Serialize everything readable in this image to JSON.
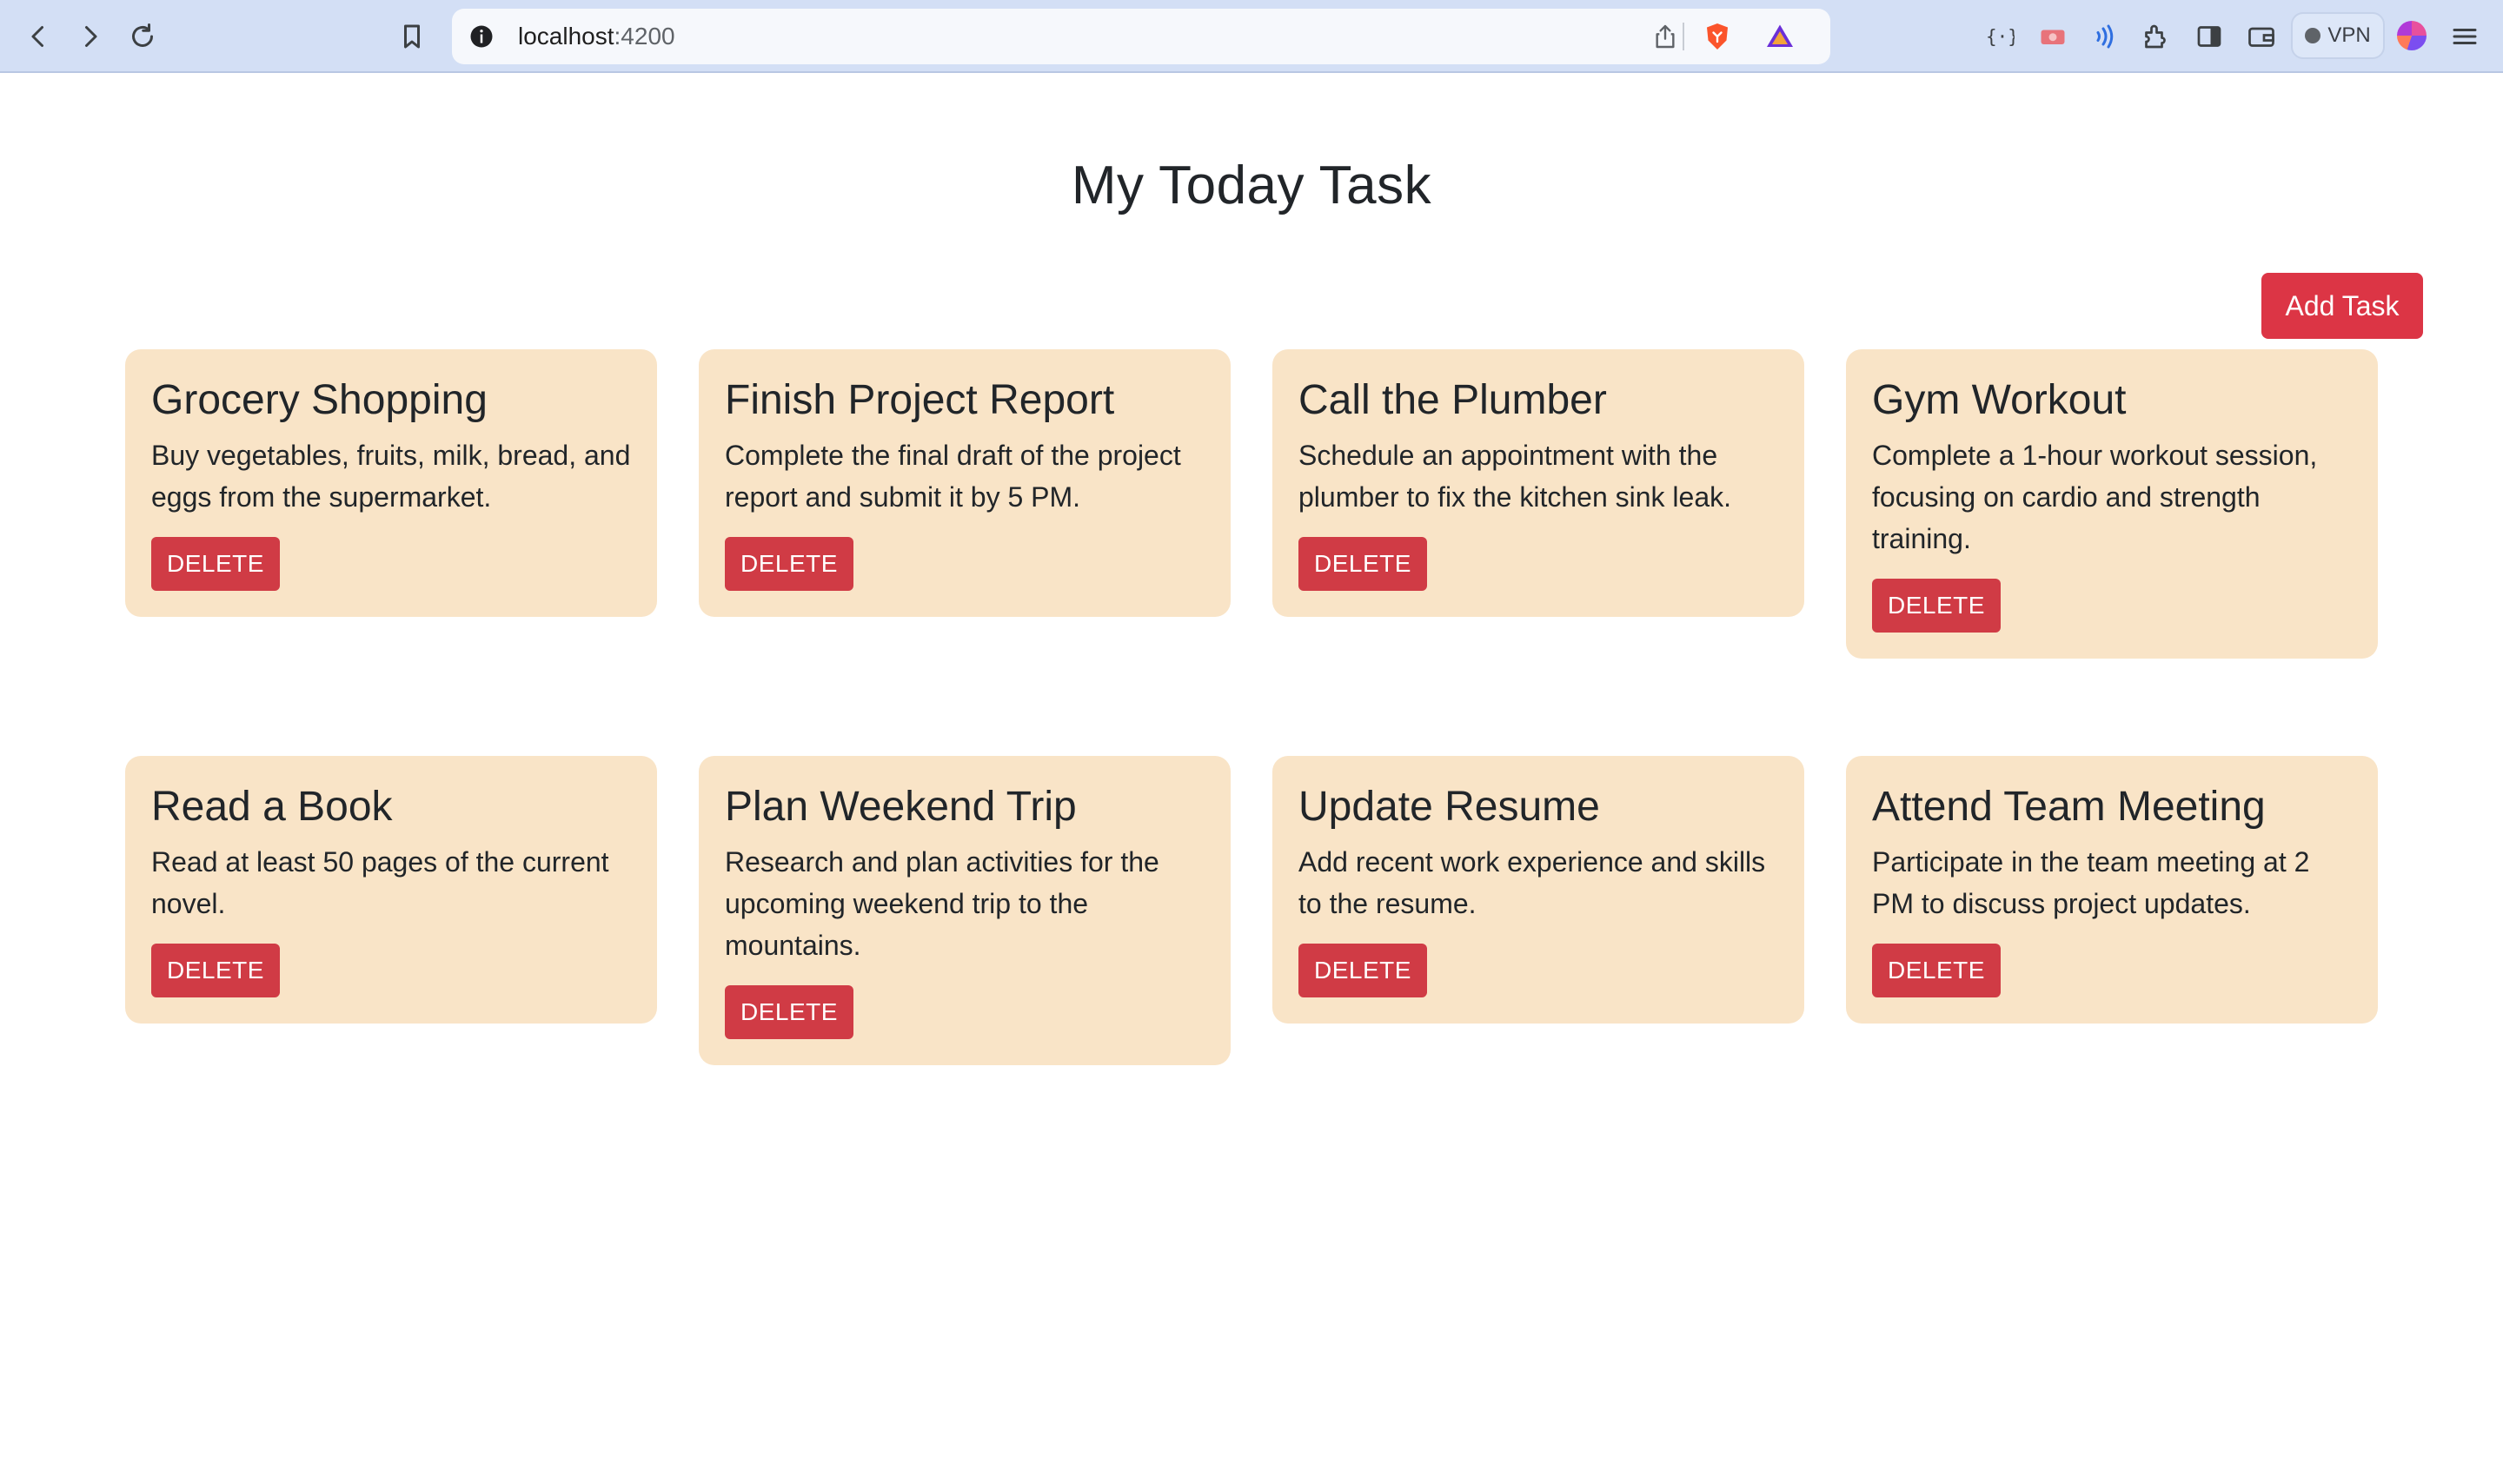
{
  "browser": {
    "url_host": "localhost",
    "url_port": ":4200",
    "vpn_label": "VPN",
    "icons": [
      "back-icon",
      "forward-icon",
      "reload-icon",
      "bookmark-icon",
      "info-icon",
      "share-icon",
      "brave-shield-icon",
      "brave-rewards-icon",
      "json-icon",
      "media-icon",
      "speech-icon",
      "extensions-icon",
      "sidebar-icon",
      "wallet-icon",
      "profile-icon",
      "menu-icon"
    ]
  },
  "page": {
    "title": "My Today Task",
    "add_button": "Add Task"
  },
  "tasks": [
    {
      "title": "Grocery Shopping",
      "description": "Buy vegetables, fruits, milk, bread, and eggs from the supermarket.",
      "delete_label": "DELETE"
    },
    {
      "title": "Finish Project Report",
      "description": "Complete the final draft of the project report and submit it by 5 PM.",
      "delete_label": "DELETE"
    },
    {
      "title": "Call the Plumber",
      "description": "Schedule an appointment with the plumber to fix the kitchen sink leak.",
      "delete_label": "DELETE"
    },
    {
      "title": "Gym Workout",
      "description": "Complete a 1-hour workout session, focusing on cardio and strength training.",
      "delete_label": "DELETE"
    },
    {
      "title": "Read a Book",
      "description": "Read at least 50 pages of the current novel.",
      "delete_label": "DELETE"
    },
    {
      "title": "Plan Weekend Trip",
      "description": "Research and plan activities for the upcoming weekend trip to the mountains.",
      "delete_label": "DELETE"
    },
    {
      "title": "Update Resume",
      "description": "Add recent work experience and skills to the resume.",
      "delete_label": "DELETE"
    },
    {
      "title": "Attend Team Meeting",
      "description": "Participate in the team meeting at 2 PM to discuss project updates.",
      "delete_label": "DELETE"
    }
  ],
  "colors": {
    "card_bg": "#f9e4c7",
    "danger": "#dc3545",
    "chrome_bg": "#d3dff5"
  }
}
